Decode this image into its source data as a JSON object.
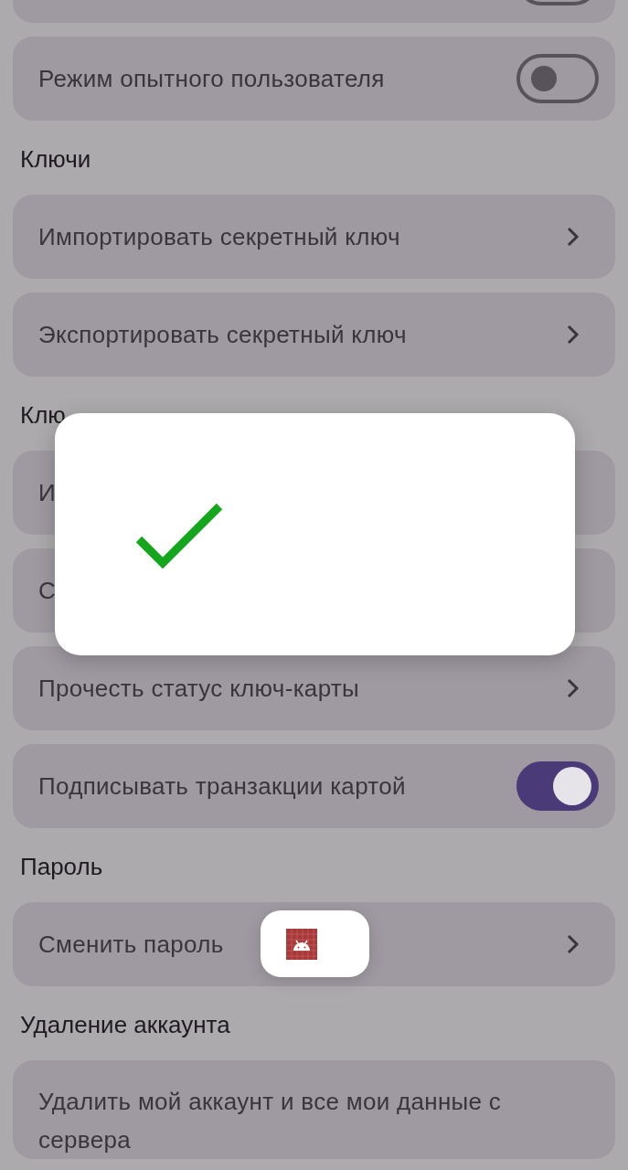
{
  "settings": [
    {
      "kind": "toggle",
      "on": false
    },
    {
      "kind": "toggle",
      "label": "Режим опытного пользователя",
      "on": false
    },
    {
      "kind": "header",
      "label": "Ключи"
    },
    {
      "kind": "nav",
      "label": "Импортировать секретный ключ"
    },
    {
      "kind": "nav",
      "label": "Экспортировать секретный ключ"
    },
    {
      "kind": "header",
      "label": "Клю"
    },
    {
      "kind": "covered",
      "label": "И"
    },
    {
      "kind": "covered",
      "label": "С"
    },
    {
      "kind": "nav",
      "label": "Прочесть статус ключ-карты"
    },
    {
      "kind": "toggle",
      "label": "Подписывать транзакции картой",
      "on": true
    },
    {
      "kind": "header",
      "label": "Пароль"
    },
    {
      "kind": "nav",
      "label": "Сменить пароль"
    },
    {
      "kind": "header",
      "label": "Удаление аккаунта"
    },
    {
      "kind": "text",
      "label": "Удалить мой аккаунт и все мои данные с сервера"
    }
  ],
  "dialog": {
    "kind": "success"
  },
  "toast": {
    "kind": "app-icon"
  }
}
